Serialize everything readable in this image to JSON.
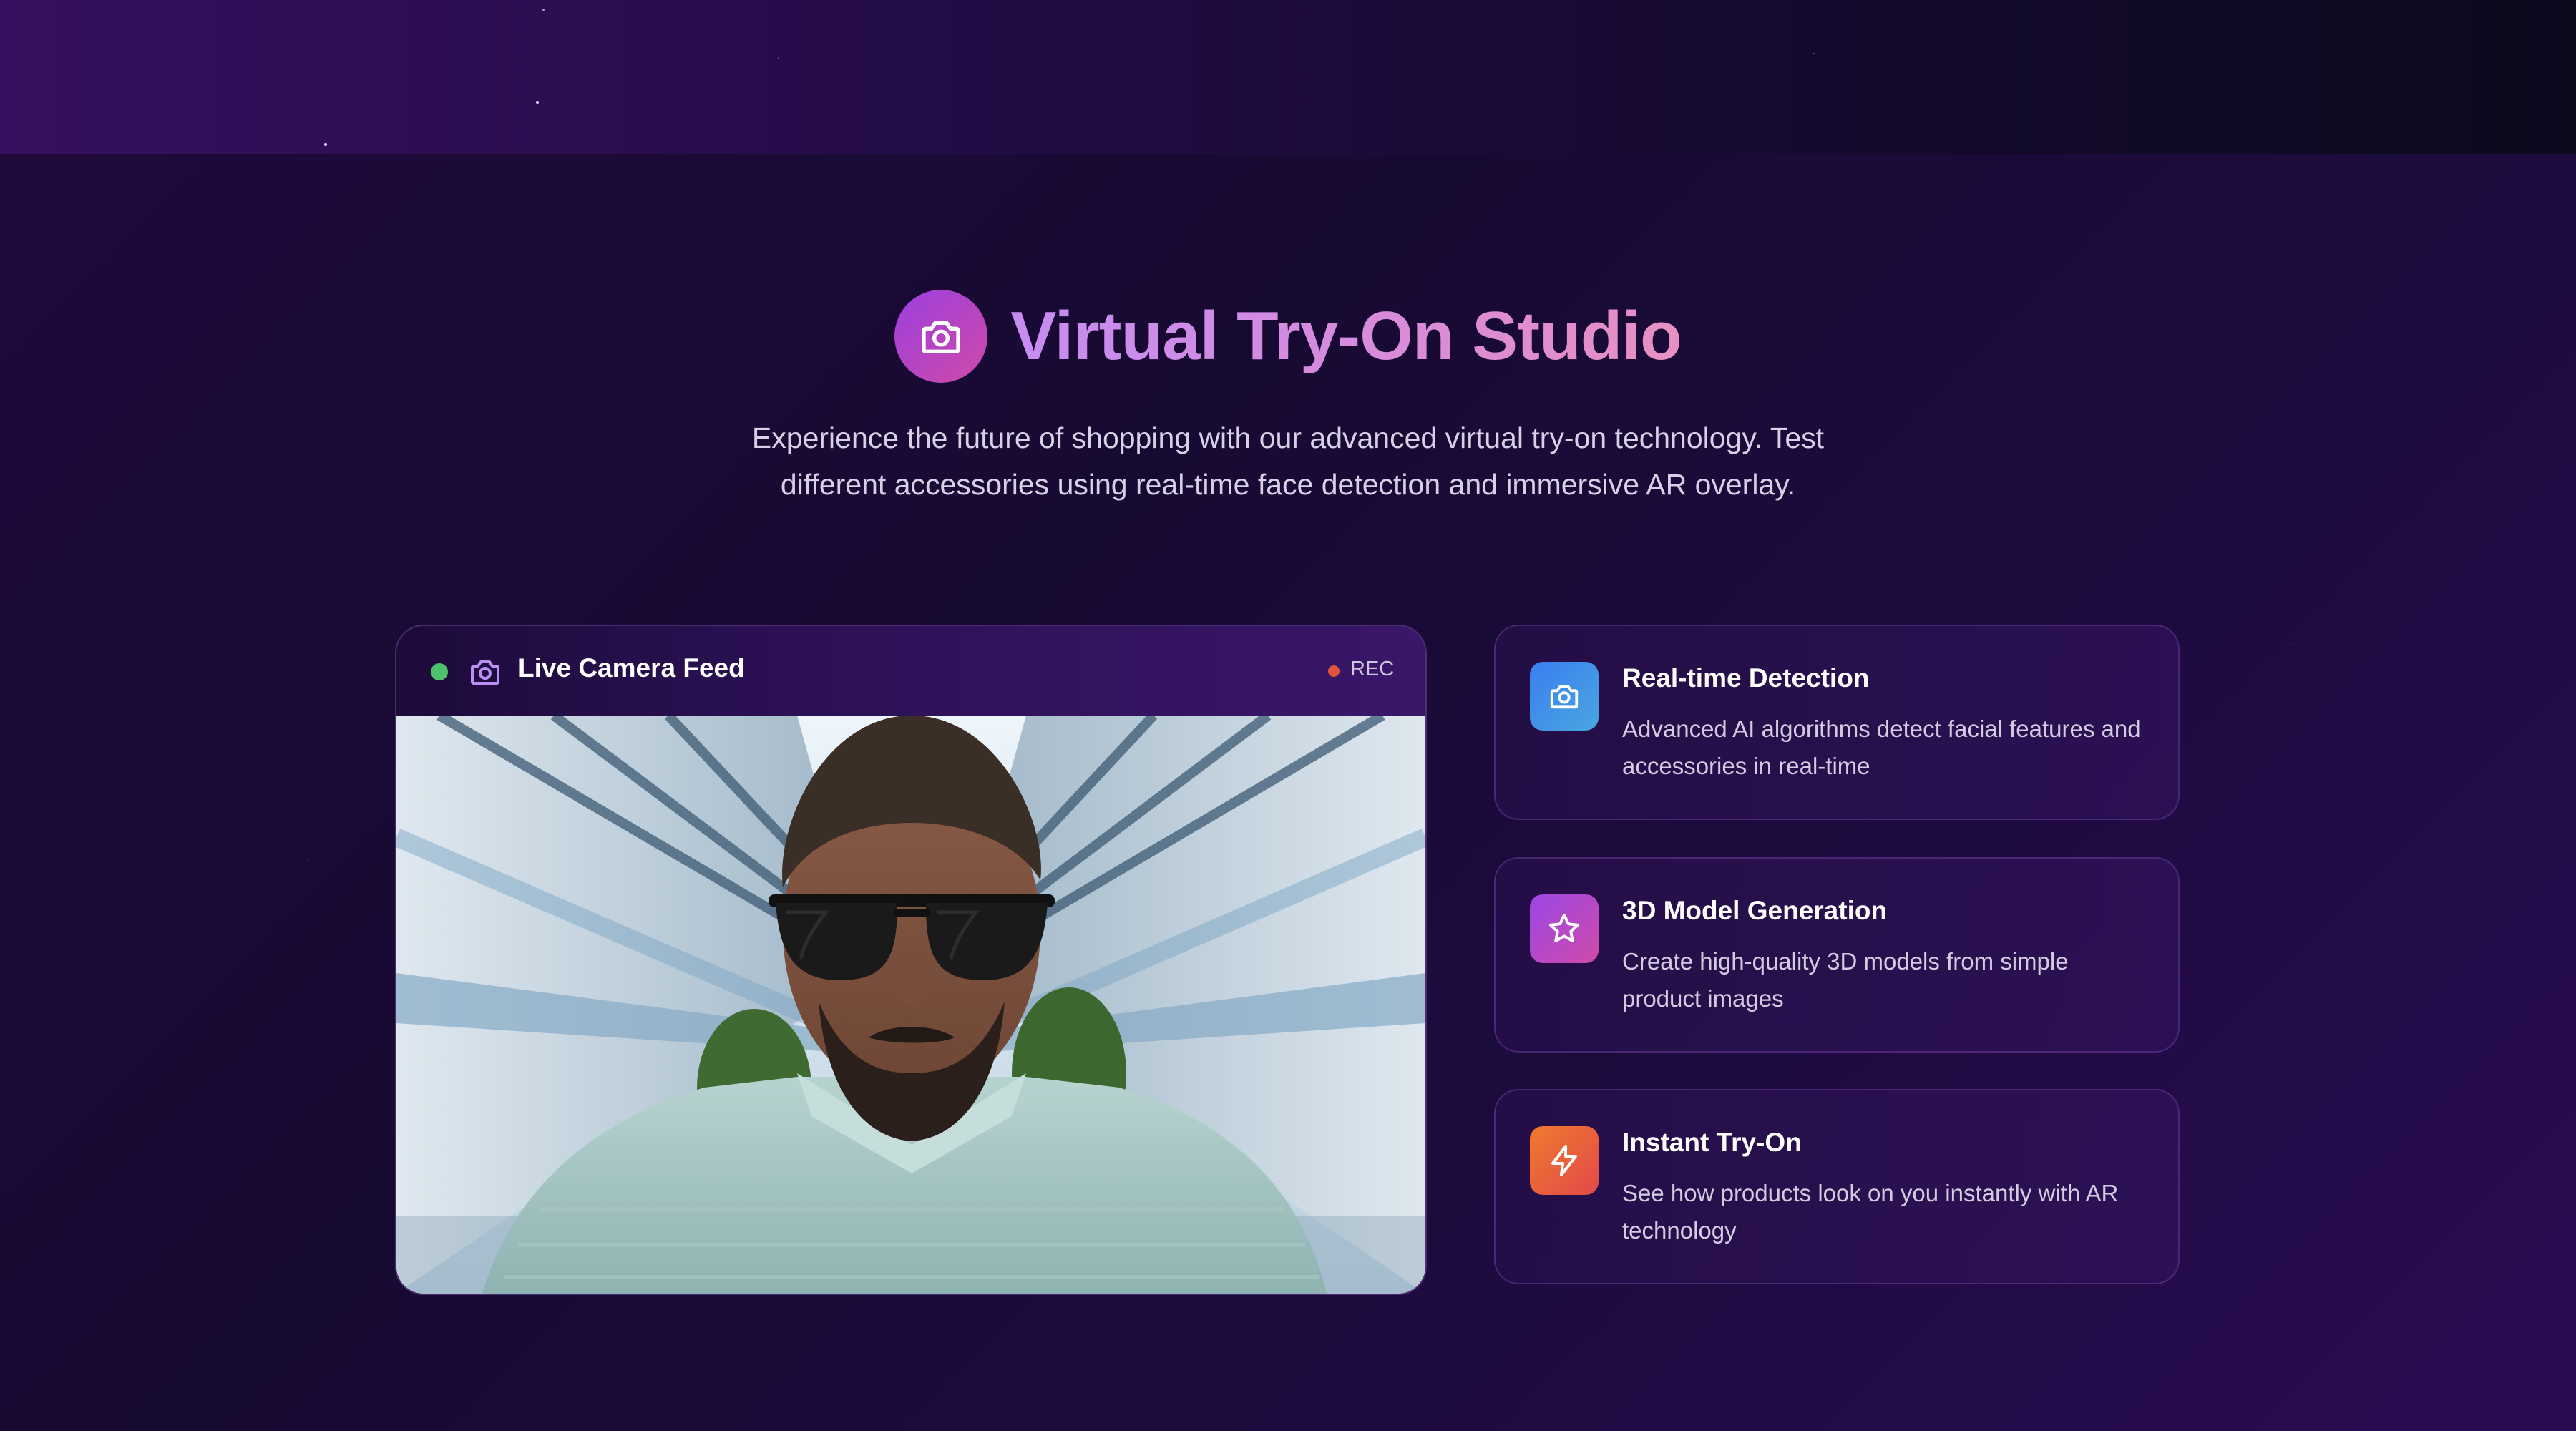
{
  "header": {
    "title": "Virtual Try-On Studio",
    "subtitle": "Experience the future of shopping with our advanced virtual try-on technology. Test different accessories using real-time face detection and immersive AR overlay.",
    "icon": "camera-icon"
  },
  "camera": {
    "title": "Live Camera Feed",
    "status_label": "REC",
    "live_indicator_color": "#4cc26a",
    "rec_indicator_color": "#e0543c",
    "icon": "camera-icon"
  },
  "features": [
    {
      "title": "Real-time Detection",
      "description": "Advanced AI algorithms detect facial features and accessories in real-time",
      "icon": "camera-icon",
      "accent": "#3a7ef0"
    },
    {
      "title": "3D Model Generation",
      "description": "Create high-quality 3D models from simple product images",
      "icon": "star-icon",
      "accent": "#b04ad0"
    },
    {
      "title": "Instant Try-On",
      "description": "See how products look on you instantly with AR technology",
      "icon": "lightning-icon",
      "accent": "#f07a2e"
    }
  ],
  "colors": {
    "background": "#1a0a36",
    "title_gradient_start": "#c58cf2",
    "title_gradient_end": "#e890c2"
  }
}
